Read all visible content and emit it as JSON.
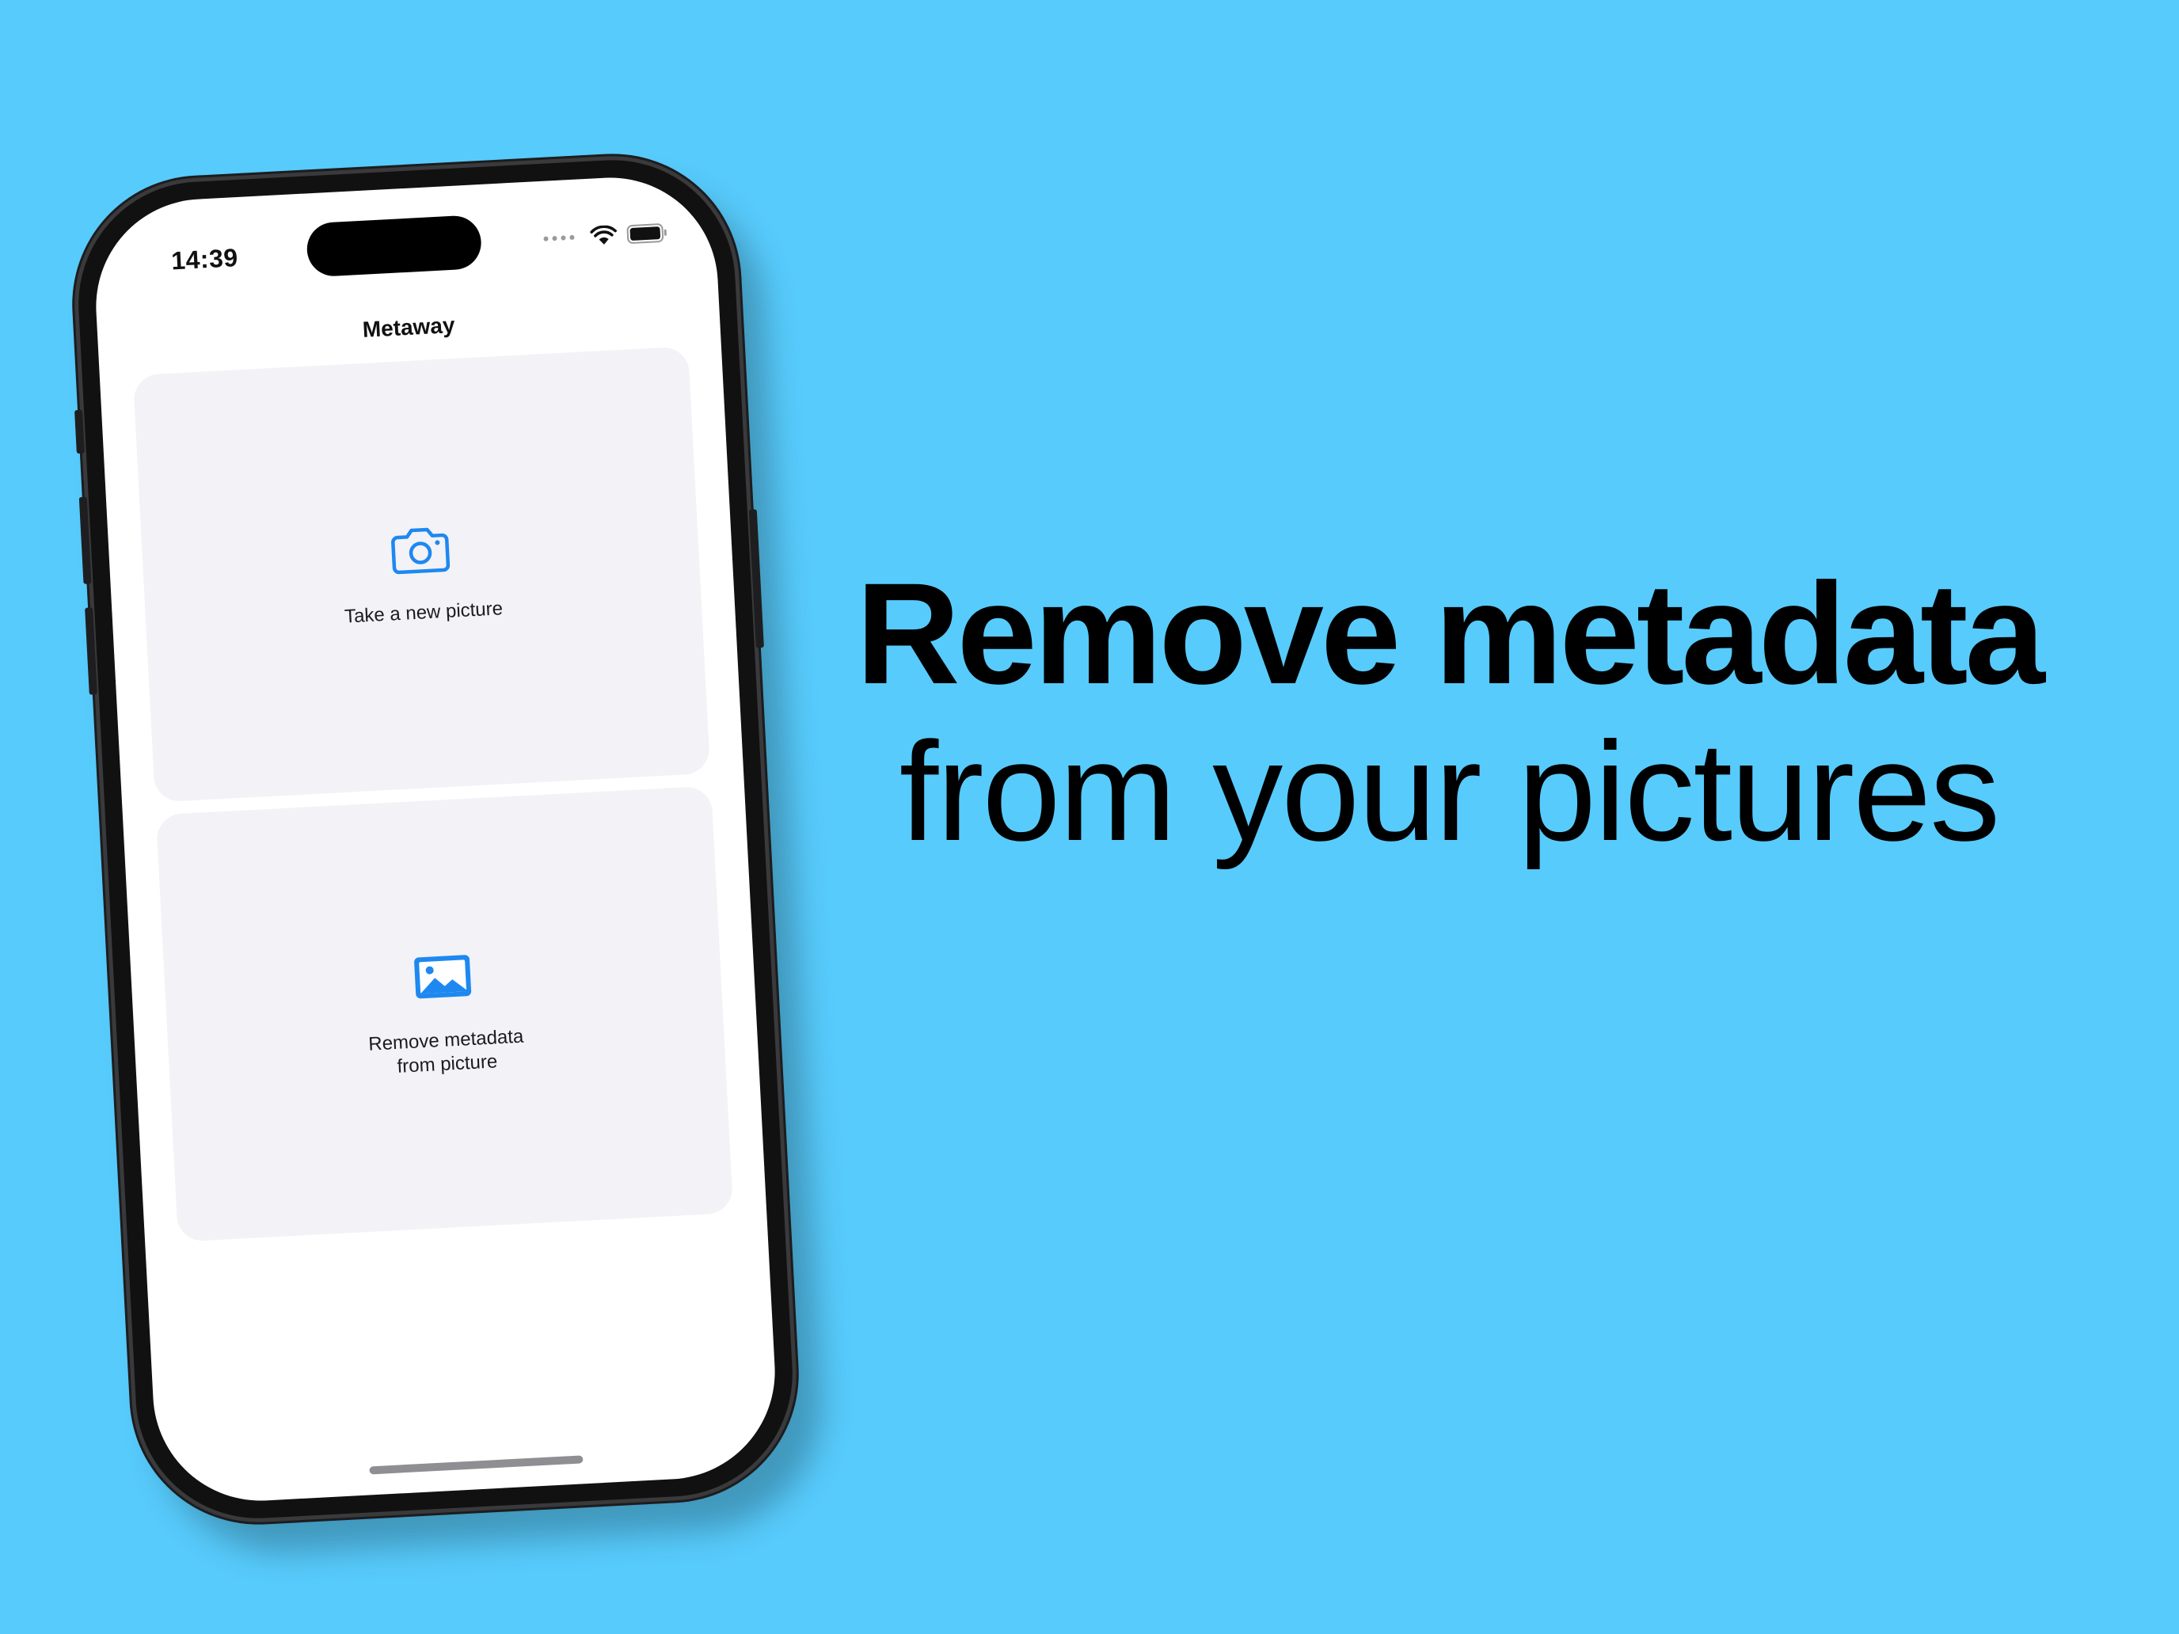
{
  "status_bar": {
    "time": "14:39"
  },
  "app": {
    "title": "Metaway"
  },
  "cards": [
    {
      "label": "Take a new picture",
      "icon": "camera-icon"
    },
    {
      "label": "Remove metadata\nfrom picture",
      "icon": "photo-icon"
    }
  ],
  "headline": {
    "line1": "Remove metadata",
    "line2": "from your pictures"
  },
  "colors": {
    "background": "#57CBFC",
    "accent": "#1E88F0",
    "card": "#F2F2F7"
  }
}
